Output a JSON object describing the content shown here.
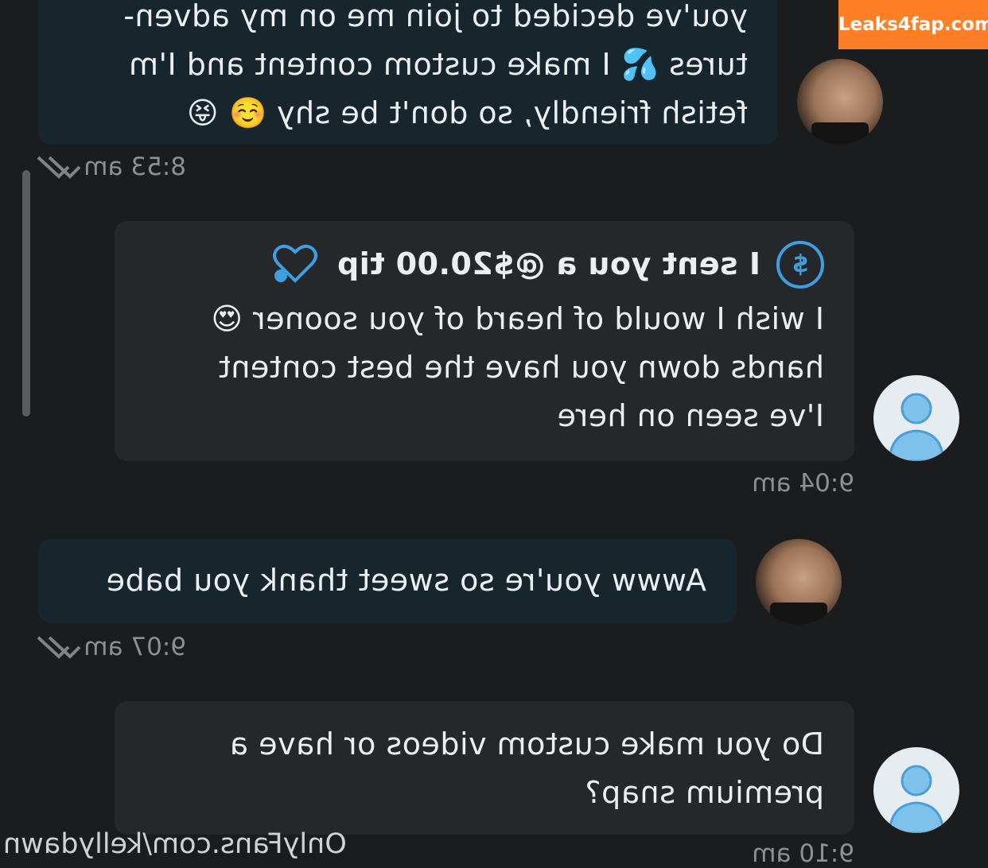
{
  "messages": [
    {
      "direction": "incoming",
      "lines": [
        "you've decided to join me on my adven-",
        "tures 💦 I make custom content and I'm",
        "fetish friendly, so don't be shy ☺️ 😝"
      ],
      "time": "8:53 am"
    },
    {
      "direction": "outgoing",
      "tip": "I sent you a @$20.00 tip",
      "lines": [
        "I wish I would of heard of you sooner 😍",
        "hands down you have the best content",
        "I've seen on here"
      ],
      "time": "9:04 am"
    },
    {
      "direction": "incoming",
      "lines": [
        "Awww you're so sweet thank you babe"
      ],
      "time": "9:07 am"
    },
    {
      "direction": "outgoing",
      "lines": [
        "Do you make custom videos or have a",
        "premium snap?"
      ],
      "time": "9:10 am"
    }
  ],
  "watermarks": {
    "site": "Leaks4fap.com",
    "profile": "OnlyFans.com/kellydawn"
  },
  "colors": {
    "background": "#1b1c1e",
    "incoming_bubble": "#17262c",
    "outgoing_bubble": "#25282b",
    "accent_blue": "#3f9ee0",
    "watermark_orange": "#ff7f27"
  },
  "icons": {
    "tip": "dollar-circle-icon",
    "like": "heart-icon",
    "read_receipt": "double-check-icon",
    "default_avatar": "user-silhouette-icon"
  }
}
